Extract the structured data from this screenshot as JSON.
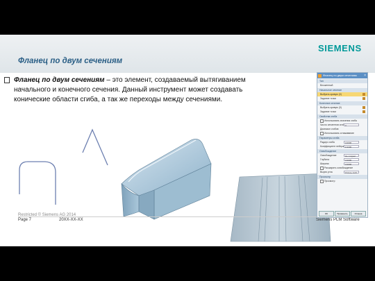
{
  "slide": {
    "title": "Фланец по двум сечениям",
    "brand": "SIEMENS",
    "body_lead": "Фланец по двум сечениям",
    "body_rest": " – это элемент, создаваемый вытягиванием начального и конечного сечения.  Данный инструмент может создавать конические области сгиба, а так же переходы между сечениями."
  },
  "footer": {
    "restricted": "Restricted © Siemens AG 2014",
    "page": "Page 7",
    "date": "20XX-XX-XX",
    "company": "Siemens PLM Software"
  },
  "dialog": {
    "title": "Фланец по двум сечениям",
    "close_glyph": "×",
    "sections": [
      {
        "header": "Тип",
        "rows": [
          {
            "label": "Вложенный",
            "value": ""
          }
        ]
      },
      {
        "header": "Начальное сечение",
        "rows": [
          {
            "label": "Выбрать кривую (0)",
            "value": "",
            "selected": true
          },
          {
            "label": "Задание точки",
            "value": ""
          }
        ]
      },
      {
        "header": "Конечное сечение",
        "rows": [
          {
            "label": "Выбрать кривую (0)",
            "value": ""
          },
          {
            "label": "Задание точки",
            "value": ""
          }
        ]
      },
      {
        "header": "Свойства сгиба",
        "rows": [
          {
            "label": "Использовать значения сгиба",
            "value": ""
          },
          {
            "label": "Число сегментов сгиба",
            "value": "3"
          },
          {
            "label": "Диапазон сгибов",
            "value": ""
          },
          {
            "label": "Использовать сглаживание",
            "value": ""
          }
        ]
      },
      {
        "header": "Параметры сгиба",
        "rows": [
          {
            "label": "Радиус сгиба",
            "value": "3.0000"
          },
          {
            "label": "Коэффициент нейтрали",
            "value": "0.3300"
          }
        ]
      },
      {
        "header": "Освобождение",
        "rows": [
          {
            "label": "Освобождение",
            "value": "Не создает"
          },
          {
            "label": "Глубина",
            "value": "3.0000"
          },
          {
            "label": "Ширина",
            "value": "3.0000"
          },
          {
            "label": "Расширить освобождение",
            "value": ""
          },
          {
            "label": "Вырез угла",
            "value": "Отсечь сгиб"
          }
        ]
      },
      {
        "header": "Просмотр",
        "rows": [
          {
            "label": "Просмотр",
            "value": ""
          }
        ]
      }
    ],
    "buttons": [
      "OK",
      "Применить",
      "Отмена"
    ]
  },
  "colors": {
    "accent": "#009999",
    "title": "#2b5f86",
    "dialog_header": "#5b8fc4"
  }
}
